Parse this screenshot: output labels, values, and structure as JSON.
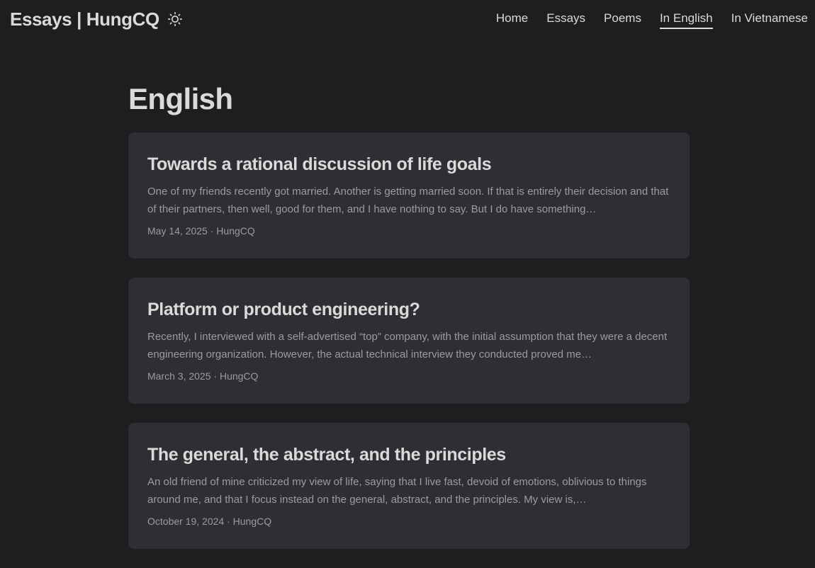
{
  "site": {
    "title": "Essays | HungCQ",
    "theme_icon": "sun-icon"
  },
  "nav": {
    "items": [
      {
        "label": "Home"
      },
      {
        "label": "Essays"
      },
      {
        "label": "Poems"
      },
      {
        "label": "In English",
        "active": true
      },
      {
        "label": "In Vietnamese"
      }
    ]
  },
  "page": {
    "title": "English"
  },
  "posts": [
    {
      "title": "Towards a rational discussion of life goals",
      "excerpt": "One of my friends recently got married. Another is getting married soon. If that is entirely their decision and that of their partners, then well, good for them, and I have nothing to say. But I do have something…",
      "date": "May 14, 2025",
      "author": "HungCQ"
    },
    {
      "title": "Platform or product engineering?",
      "excerpt": "Recently, I interviewed with a self-advertised “top” company, with the initial assumption that they were a decent engineering organization. However, the actual technical interview they conducted proved me…",
      "date": "March 3, 2025",
      "author": "HungCQ"
    },
    {
      "title": "The general, the abstract, and the principles",
      "excerpt": "An old friend of mine criticized my view of life, saying that I live fast, devoid of emotions, oblivious to things around me, and that I focus instead on the general, abstract, and the principles. My view is,…",
      "date": "October 19, 2024",
      "author": "HungCQ"
    }
  ],
  "colors": {
    "background": "#1d1e20",
    "card": "#2e2e33",
    "text": "#dadadb",
    "secondary": "#9b9c9d"
  }
}
